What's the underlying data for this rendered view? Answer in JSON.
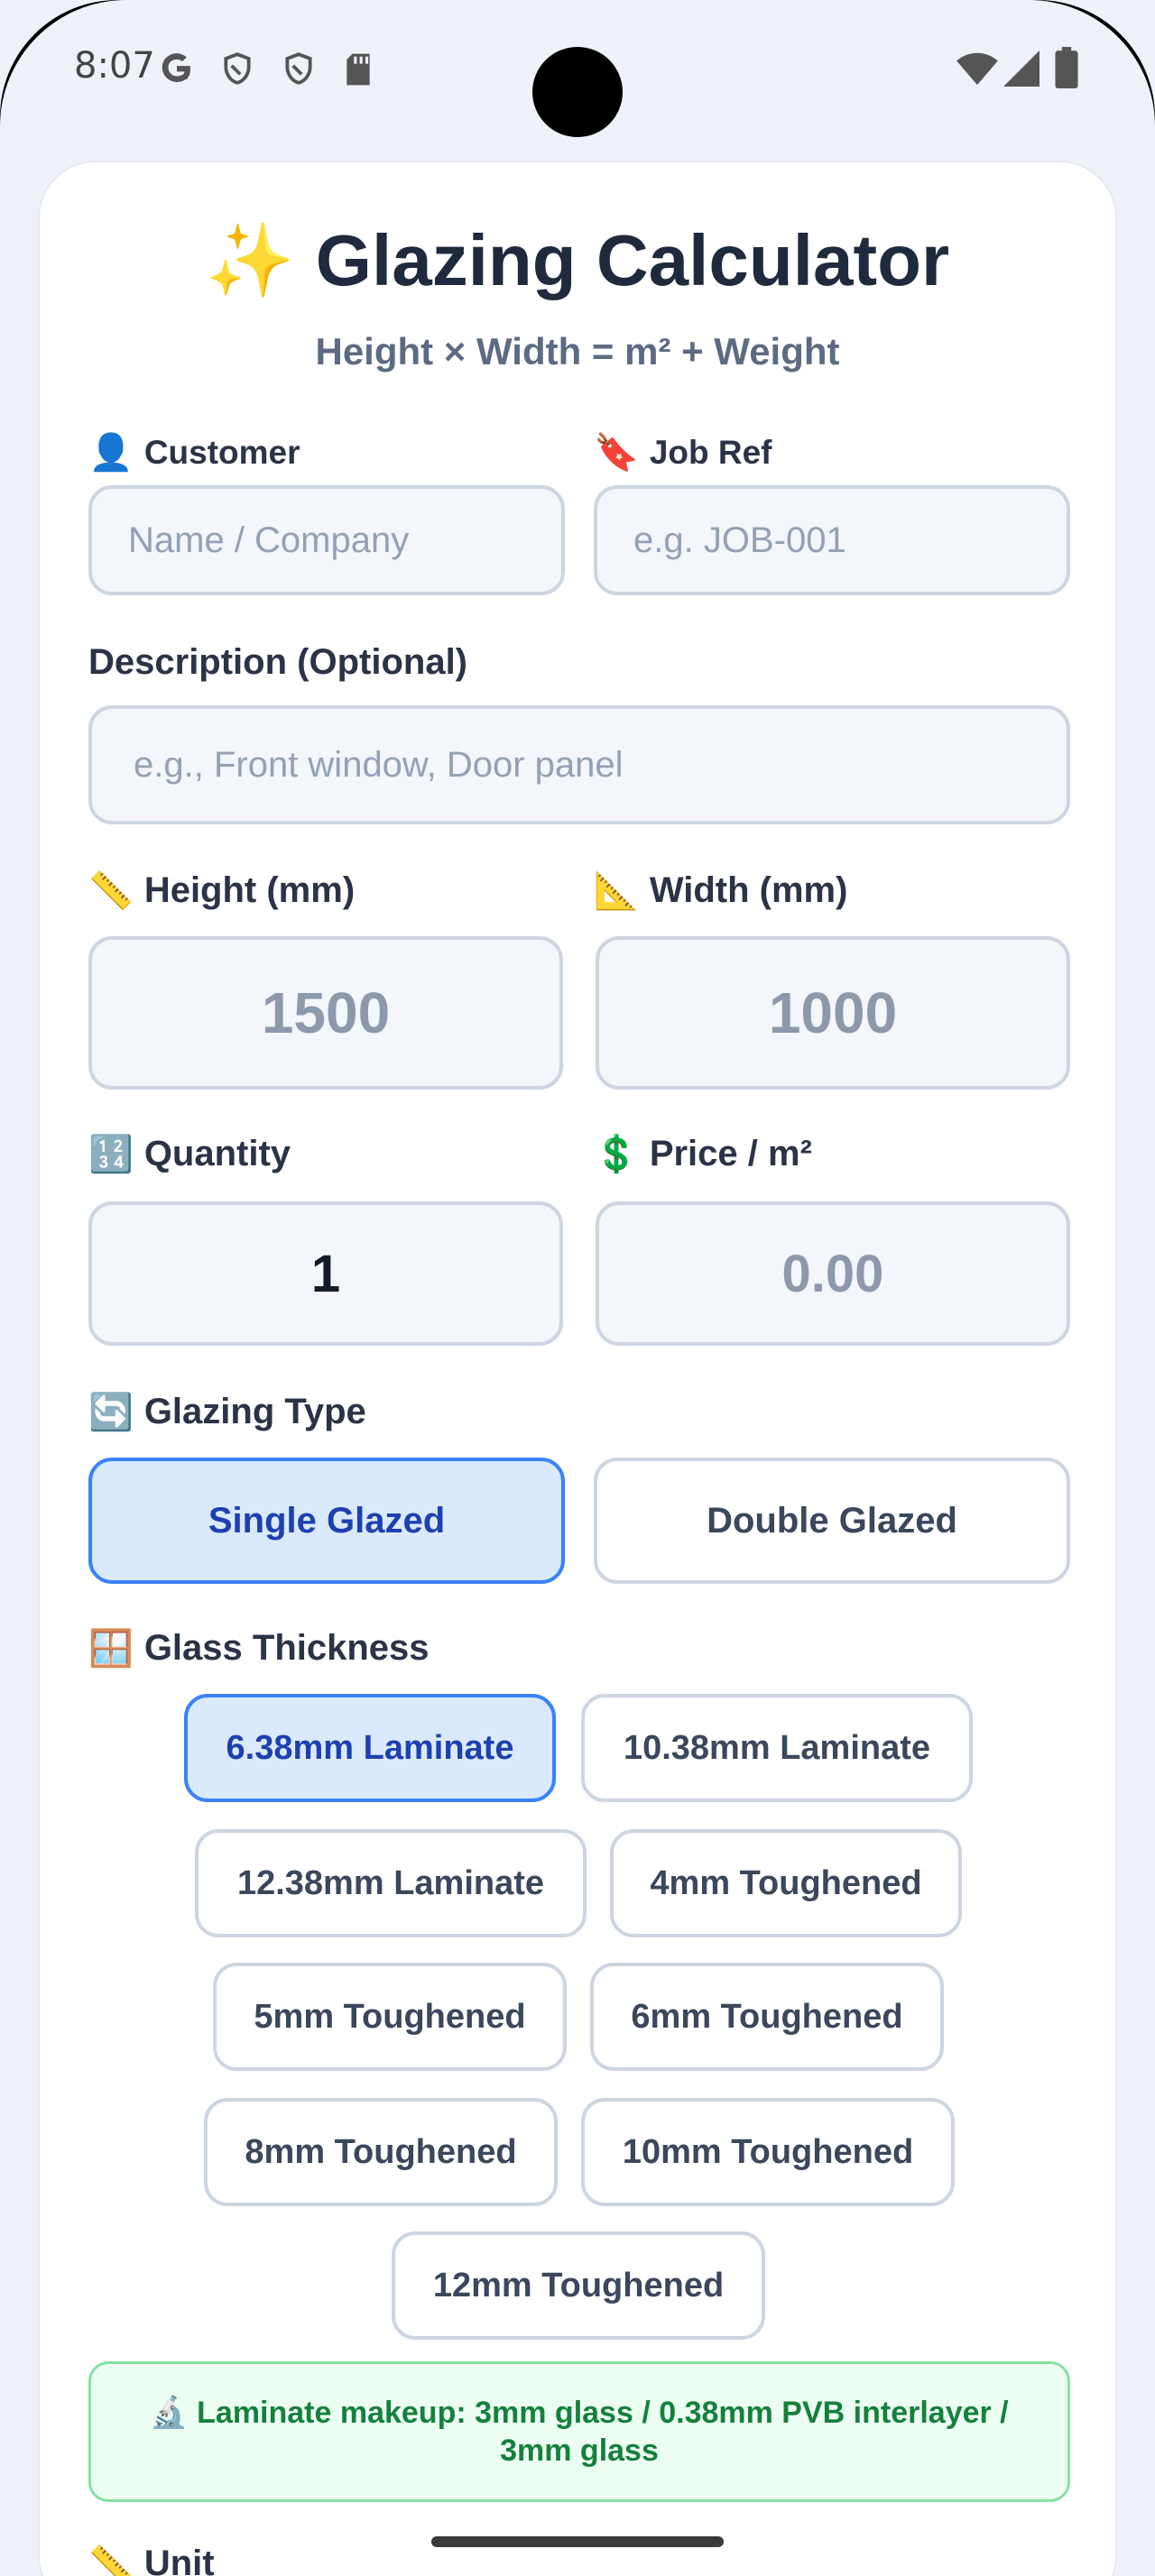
{
  "status_bar": {
    "time": "8:07",
    "icons": [
      "google-g-icon",
      "shield-icon",
      "shield-icon",
      "sd-card-icon",
      "wifi-icon",
      "signal-icon",
      "battery-icon"
    ]
  },
  "header": {
    "emoji": "✨",
    "title": "Glazing Calculator",
    "subtitle": "Height × Width = m² + Weight"
  },
  "fields": {
    "customer": {
      "icon": "👤",
      "label": "Customer",
      "placeholder": "Name / Company"
    },
    "job_ref": {
      "icon": "🔖",
      "label": "Job Ref",
      "placeholder": "e.g. JOB-001"
    },
    "description": {
      "label": "Description (Optional)",
      "placeholder": "e.g., Front window, Door panel"
    },
    "height": {
      "icon": "📏",
      "label": "Height (mm)",
      "placeholder": "1500"
    },
    "width": {
      "icon": "📐",
      "label": "Width (mm)",
      "placeholder": "1000"
    },
    "quantity": {
      "icon": "🔢",
      "label": "Quantity",
      "value": "1"
    },
    "price": {
      "icon": "💲",
      "label": "Price / m²",
      "placeholder": "0.00"
    }
  },
  "glazing_type": {
    "icon": "🔄",
    "label": "Glazing Type",
    "options": [
      "Single Glazed",
      "Double Glazed"
    ],
    "selected": "Single Glazed"
  },
  "glass_thickness": {
    "icon": "🪟",
    "label": "Glass Thickness",
    "options": [
      "6.38mm Laminate",
      "10.38mm Laminate",
      "12.38mm Laminate",
      "4mm Toughened",
      "5mm Toughened",
      "6mm Toughened",
      "8mm Toughened",
      "10mm Toughened",
      "12mm Toughened"
    ],
    "selected": "6.38mm Laminate"
  },
  "info": {
    "icon": "🔬",
    "text": "Laminate makeup: 3mm glass / 0.38mm PVB interlayer / 3mm glass"
  },
  "unit": {
    "icon": "📏",
    "label": "Unit"
  },
  "colors": {
    "accent": "#3b82f6",
    "accent_bg": "#dbe9fd",
    "info_green": "#15803d",
    "info_bg": "#ecfdf2"
  }
}
